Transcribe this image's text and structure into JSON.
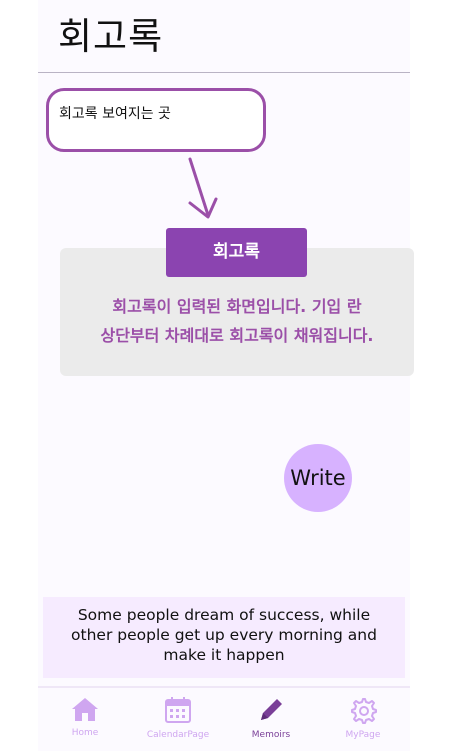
{
  "header": {
    "title": "회고록"
  },
  "callout": {
    "text": "회고록 보여지는 곳"
  },
  "memo": {
    "tab_label": "회고록",
    "description_line1": "회고록이 입력된 화면입니다. 기입 란",
    "description_line2": "상단부터 차례대로 회고록이 채워집니다."
  },
  "write_button": {
    "label": "Write"
  },
  "quote": {
    "line1": "Some people dream of success, while",
    "line2": "other people get up every morning and",
    "line3": "make it happen"
  },
  "tabbar": {
    "items": [
      {
        "label": "Home",
        "icon": "home-icon",
        "active": false
      },
      {
        "label": "CalendarPage",
        "icon": "calendar-icon",
        "active": false
      },
      {
        "label": "Memoirs",
        "icon": "pencil-icon",
        "active": true
      },
      {
        "label": "MyPage",
        "icon": "gear-icon",
        "active": false
      }
    ]
  },
  "colors": {
    "accent": "#8b44b0",
    "accent_light": "#d7b2ff",
    "inactive_tab": "#cfa6f0",
    "active_tab": "#7a3f98"
  }
}
